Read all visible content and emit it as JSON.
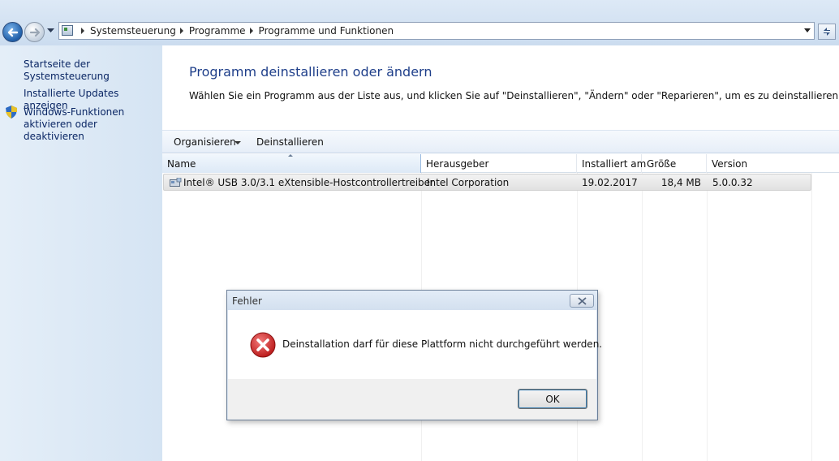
{
  "address_bar": {
    "breadcrumbs": [
      "Systemsteuerung",
      "Programme",
      "Programme und Funktionen"
    ]
  },
  "sidebar": {
    "items": [
      {
        "label": "Startseite der Systemsteuerung"
      },
      {
        "label": "Installierte Updates anzeigen"
      },
      {
        "label": "Windows-Funktionen aktivieren oder deaktivieren",
        "icon": "shield-icon"
      }
    ]
  },
  "main": {
    "title": "Programm deinstallieren oder ändern",
    "description": "Wählen Sie ein Programm aus der Liste aus, und klicken Sie auf \"Deinstallieren\", \"Ändern\" oder \"Reparieren\", um es zu deinstallieren."
  },
  "toolbar": {
    "organize_label": "Organisieren",
    "uninstall_label": "Deinstallieren"
  },
  "table": {
    "columns": [
      "Name",
      "Herausgeber",
      "Installiert am",
      "Größe",
      "Version"
    ],
    "rows": [
      {
        "name": "Intel® USB 3.0/3.1 eXtensible-Hostcontrollertreiber",
        "publisher": "Intel Corporation",
        "installed": "19.02.2017",
        "size": "18,4 MB",
        "version": "5.0.0.32",
        "selected": true
      }
    ]
  },
  "dialog": {
    "title": "Fehler",
    "message": "Deinstallation darf für diese Plattform nicht durchgeführt werden.",
    "ok_label": "OK",
    "icon": "error-icon"
  },
  "colors": {
    "title_blue": "#1f3f8a",
    "link_blue": "#0a2664",
    "sidebar_bg": "#dbe8f5",
    "error_red": "#d42424"
  }
}
